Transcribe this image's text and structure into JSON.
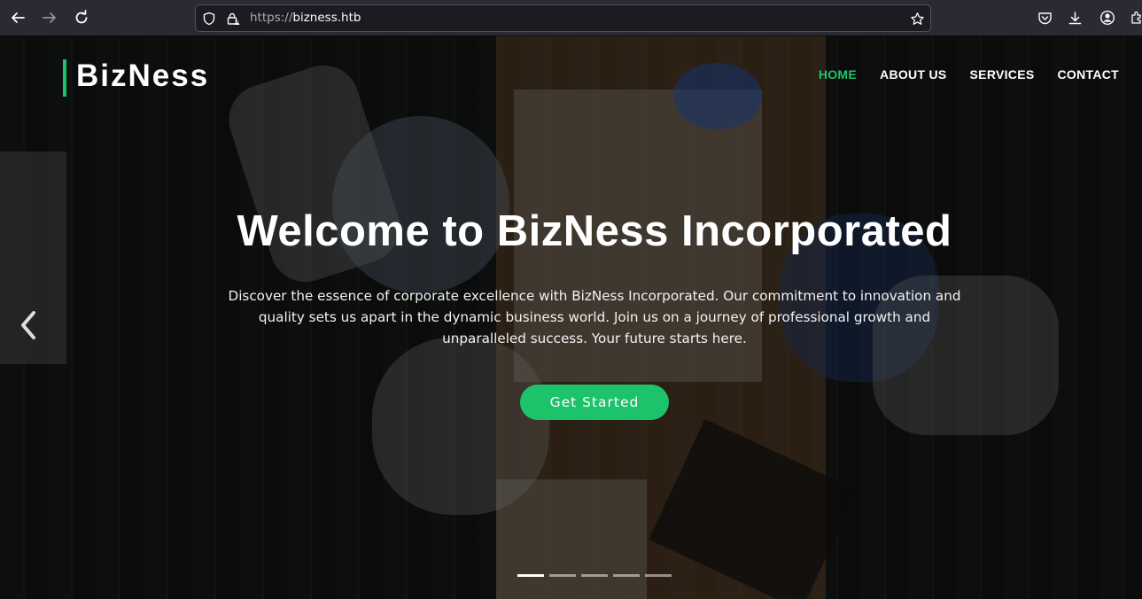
{
  "browser": {
    "url_scheme": "https://",
    "url_host": "bizness.htb",
    "icons": [
      "back-icon",
      "forward-icon",
      "reload-icon",
      "shield-icon",
      "lock-warning-icon",
      "star-icon",
      "pocket-icon",
      "download-icon",
      "account-icon",
      "extensions-icon"
    ]
  },
  "site": {
    "logo": "BizNess",
    "nav": [
      {
        "label": "HOME",
        "active": true
      },
      {
        "label": "ABOUT US",
        "active": false
      },
      {
        "label": "SERVICES",
        "active": false
      },
      {
        "label": "CONTACT",
        "active": false
      }
    ]
  },
  "hero": {
    "title": "Welcome to BizNess Incorporated",
    "subtitle": "Discover the essence of corporate excellence with BizNess Incorporated. Our commitment to innovation and quality sets us apart in the dynamic business world. Join us on a journey of professional growth and unparalleled success. Your future starts here.",
    "cta_label": "Get Started",
    "slides_total": 5,
    "slide_active": 1
  },
  "colors": {
    "accent": "#1dc36b",
    "browser_bg": "#2b2a33"
  }
}
